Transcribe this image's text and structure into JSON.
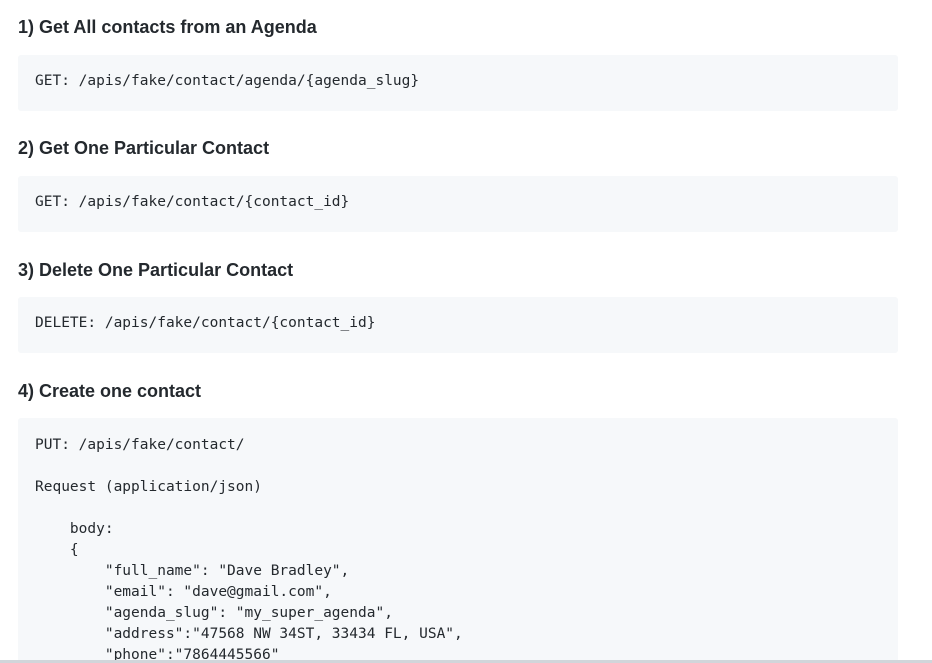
{
  "sections": [
    {
      "heading": "1) Get All contacts from an Agenda",
      "code": [
        "GET: /apis/fake/contact/agenda/{agenda_slug}"
      ]
    },
    {
      "heading": "2) Get One Particular Contact",
      "code": [
        "GET: /apis/fake/contact/{contact_id}"
      ]
    },
    {
      "heading": "3) Delete One Particular Contact",
      "code": [
        "DELETE: /apis/fake/contact/{contact_id}"
      ]
    },
    {
      "heading": "4) Create one contact",
      "code": [
        "PUT: /apis/fake/contact/",
        "",
        "Request (application/json)",
        "",
        "    body:",
        "    {",
        "        \"full_name\": \"Dave Bradley\",",
        "        \"email\": \"dave@gmail.com\",",
        "        \"agenda_slug\": \"my_super_agenda\",",
        "        \"address\":\"47568 NW 34ST, 33434 FL, USA\",",
        "        \"phone\":\"7864445566\""
      ]
    }
  ]
}
